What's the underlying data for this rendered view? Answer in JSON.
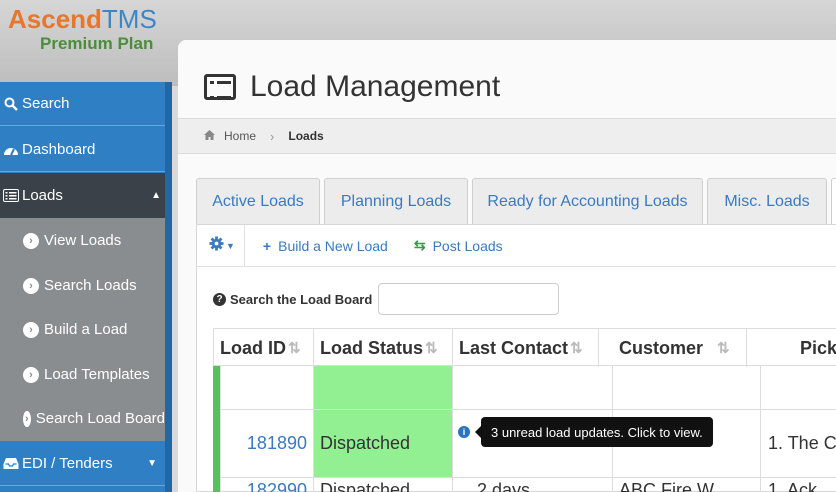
{
  "brand": {
    "name_part1": "Ascend",
    "name_part2": "TMS",
    "plan": "Premium Plan"
  },
  "sidebar": {
    "items": [
      {
        "label": "Search",
        "icon": "search-icon"
      },
      {
        "label": "Dashboard",
        "icon": "dashboard-icon"
      },
      {
        "label": "Loads",
        "icon": "list-icon",
        "expanded": true
      },
      {
        "label": "View Loads",
        "icon": "chevron-circle-right-icon"
      },
      {
        "label": "Search Loads",
        "icon": "chevron-circle-right-icon"
      },
      {
        "label": "Build a Load",
        "icon": "chevron-circle-right-icon"
      },
      {
        "label": "Load Templates",
        "icon": "chevron-circle-right-icon"
      },
      {
        "label": "Search Load Board",
        "icon": "chevron-circle-right-icon"
      },
      {
        "label": "EDI / Tenders",
        "icon": "inbox-icon"
      }
    ]
  },
  "page": {
    "title": "Load Management"
  },
  "breadcrumb": {
    "home": "Home",
    "current": "Loads"
  },
  "tabs": [
    "Active Loads",
    "Planning Loads",
    "Ready for Accounting Loads",
    "Misc. Loads"
  ],
  "toolbar": {
    "build_label": "Build a New Load",
    "post_label": "Post Loads"
  },
  "search": {
    "label": "Search the Load Board",
    "value": "",
    "placeholder": ""
  },
  "table": {
    "columns": [
      "Load ID",
      "Load Status",
      "Last Contact",
      "Customer",
      "Pick"
    ],
    "rows": [
      {
        "load_id": "",
        "status": "",
        "last_contact": "",
        "customer": "",
        "pick": ""
      },
      {
        "load_id": "181890",
        "status": "Dispatched",
        "last_contact": "",
        "customer": "",
        "pick": "1. The C"
      },
      {
        "load_id": "182990",
        "status": "Dispatched",
        "last_contact": "2 days",
        "customer": "ABC Fire W",
        "pick": "1. Ack"
      }
    ]
  },
  "tooltip": {
    "text": "3 unread load updates. Click to view."
  },
  "colors": {
    "accent": "#3a7ac0",
    "sidebar": "#2f7fc4",
    "status_green": "#92ef92",
    "row_marker": "#57c15a"
  }
}
